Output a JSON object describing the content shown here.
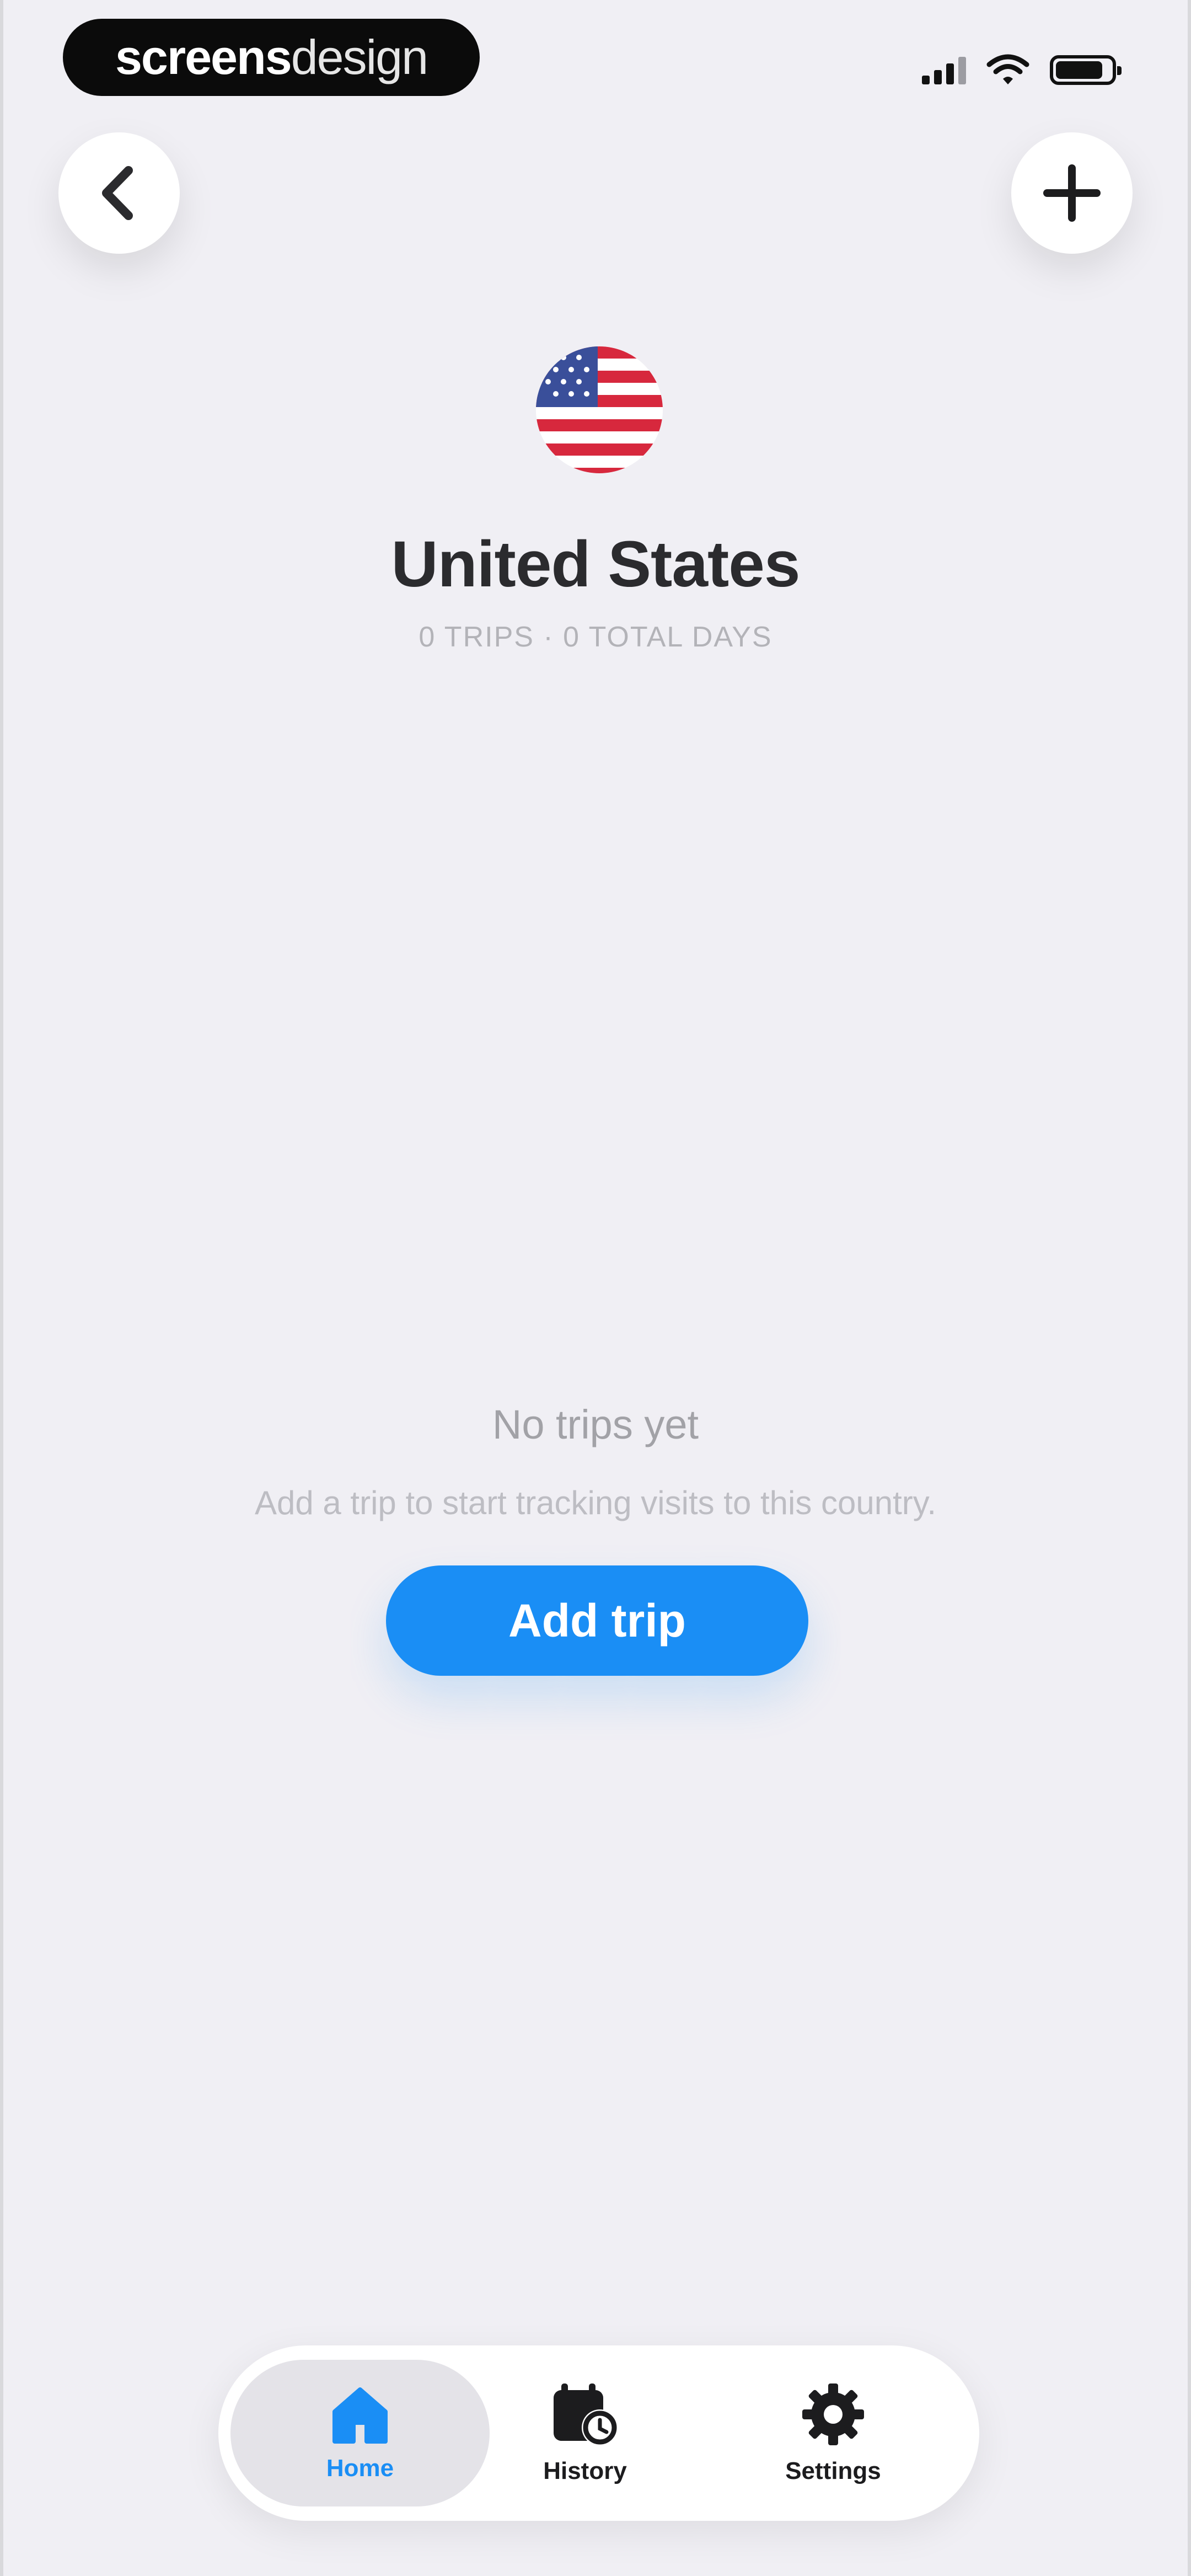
{
  "watermark": {
    "bold": "screens",
    "light": "design"
  },
  "header": {
    "country": "United States",
    "stats": "0 TRIPS · 0 TOTAL DAYS"
  },
  "empty_state": {
    "title": "No trips yet",
    "description": "Add a trip to start tracking visits to this country.",
    "button_label": "Add trip"
  },
  "tabbar": {
    "tabs": [
      {
        "label": "Home",
        "icon": "home-icon",
        "active": true
      },
      {
        "label": "History",
        "icon": "calendar-clock-icon",
        "active": false
      },
      {
        "label": "Settings",
        "icon": "gear-icon",
        "active": false
      }
    ]
  },
  "colors": {
    "accent": "#1a8ef5",
    "background": "#f0eff4",
    "title": "#2b2b2e",
    "muted": "#a2a2a7"
  }
}
